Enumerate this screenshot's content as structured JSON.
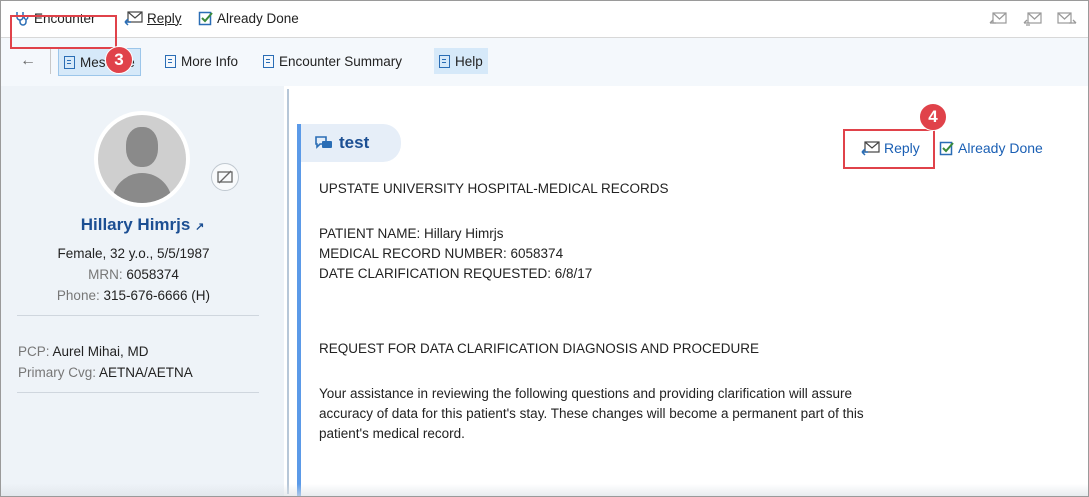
{
  "toolbar": {
    "encounter_label": "Encounter",
    "reply_label": "Reply",
    "already_done_label": "Already Done",
    "right_icons": [
      "reply-envelope-icon",
      "reply-all-envelope-icon",
      "forward-envelope-icon"
    ]
  },
  "subtabs": {
    "items": [
      "Message",
      "More Info",
      "Encounter Summary",
      "Help"
    ],
    "active": "Message"
  },
  "patient": {
    "name": "Hillary Himrjs",
    "demographics": "Female, 32 y.o., 5/5/1987",
    "mrn_label": "MRN:",
    "mrn": "6058374",
    "phone_label": "Phone:",
    "phone": "315-676-6666 (H)",
    "pcp_label": "PCP:",
    "pcp": "Aurel Mihai, MD",
    "coverage_label": "Primary Cvg:",
    "coverage": "AETNA/AETNA"
  },
  "message": {
    "subject": "test",
    "reply_label": "Reply",
    "already_done_label": "Already Done",
    "lines": [
      "UPSTATE UNIVERSITY HOSPITAL-MEDICAL RECORDS",
      "PATIENT NAME:  Hillary Himrjs",
      "MEDICAL RECORD NUMBER:  6058374",
      "DATE CLARIFICATION REQUESTED: 6/8/17",
      "REQUEST FOR DATA CLARIFICATION DIAGNOSIS AND PROCEDURE",
      "Your assistance in reviewing the following questions and providing clarification will assure",
      "accuracy of data for this patient's stay. These changes will become a permanent part of this",
      "patient's medical record."
    ]
  },
  "annotations": {
    "step_encounter": "3",
    "step_reply": "4",
    "highlight_color": "#e0424a"
  },
  "colors": {
    "accent": "#1c4f93",
    "link": "#1a5fb4",
    "message_bar": "#5b9ae8"
  }
}
